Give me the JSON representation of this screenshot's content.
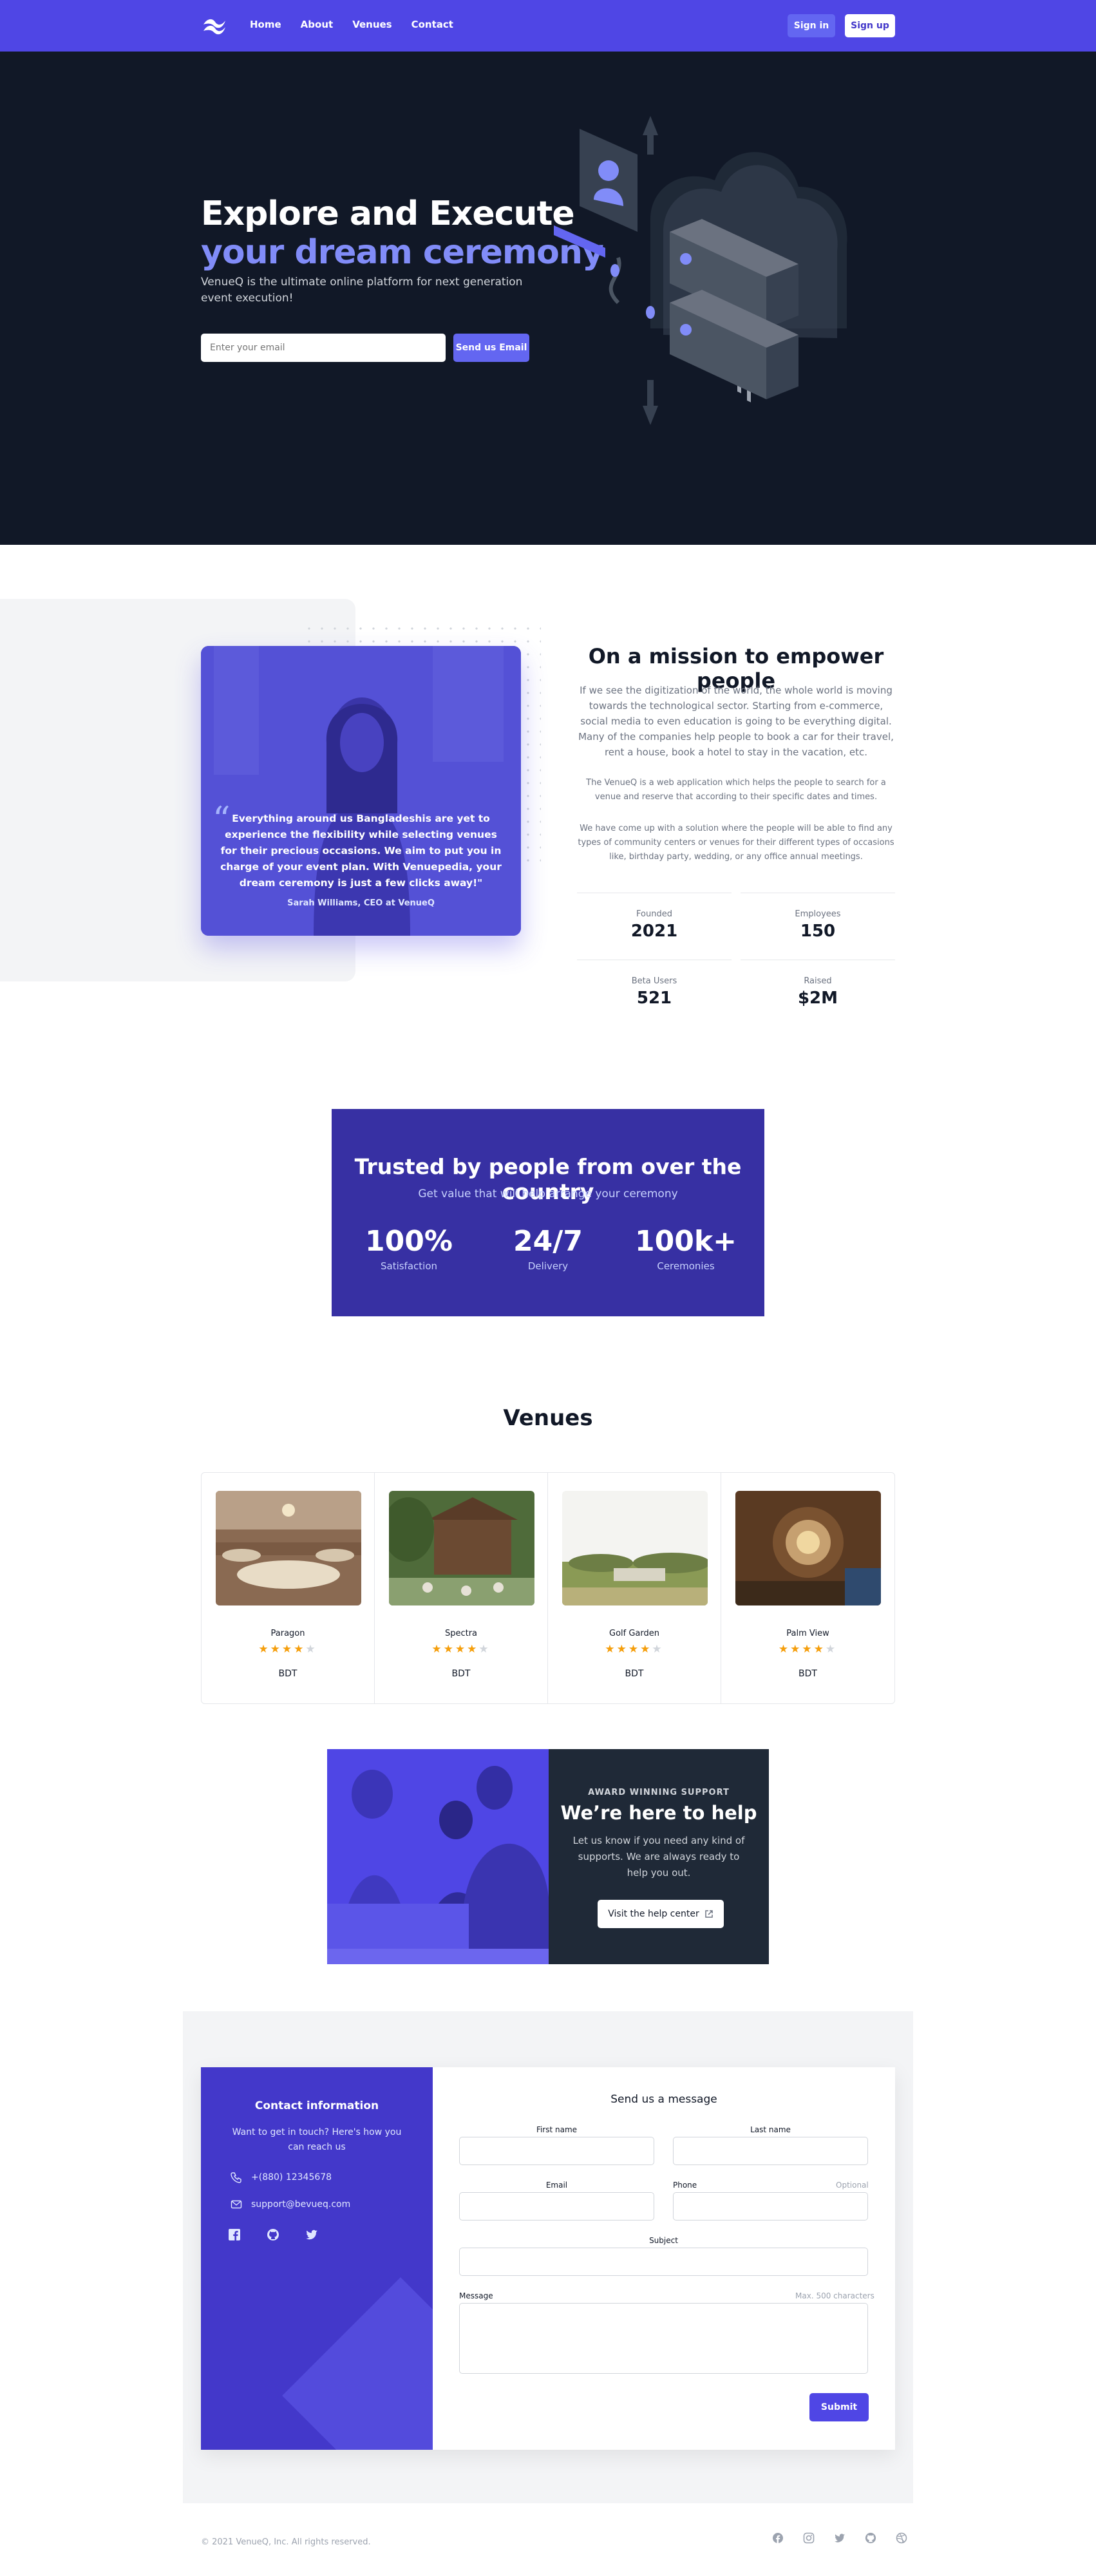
{
  "nav": {
    "links": [
      "Home",
      "About",
      "Venues",
      "Contact"
    ],
    "signin": "Sign in",
    "signup": "Sign up"
  },
  "hero": {
    "title_line1": "Explore and Execute",
    "title_line2": "your dream ceremony",
    "subtitle": "VenueQ is the ultimate online platform for next generation event execution!",
    "email_placeholder": "Enter your email",
    "send_button": "Send us Email"
  },
  "mission": {
    "quote": "Everything around us Bangladeshis are yet to experience the flexibility while selecting venues for their precious occasions. We aim to put you in charge of your event plan. With Venuepedia, your dream ceremony is just a few clicks away!\"",
    "quote_author": "Sarah Williams, CEO at VenueQ",
    "title": "On a mission to empower people",
    "paragraph1": "If we see the digitization of the world, the whole world is moving towards the technological sector. Starting from e-commerce, social media to even education is going to be everything digital. Many of the companies help people to book a car for their travel, rent a house, book a hotel to stay in the vacation, etc.",
    "paragraph2": "The VenueQ is a web application which helps the people to search for a venue and reserve that according to their specific dates and times.",
    "paragraph3": "We have come up with a solution where the people will be able to find any types of community centers or venues for their different types of occasions like, birthday party, wedding, or any office annual meetings.",
    "stats": [
      {
        "label": "Founded",
        "value": "2021"
      },
      {
        "label": "Employees",
        "value": "150"
      },
      {
        "label": "Beta Users",
        "value": "521"
      },
      {
        "label": "Raised",
        "value": "$2M"
      }
    ]
  },
  "trusted": {
    "title": "Trusted by people from over the country",
    "subtitle": "Get value that will help arrange your ceremony",
    "stats": [
      {
        "value": "100%",
        "label": "Satisfaction"
      },
      {
        "value": "24/7",
        "label": "Delivery"
      },
      {
        "value": "100k+",
        "label": "Ceremonies"
      }
    ]
  },
  "venues": {
    "title": "Venues",
    "items": [
      {
        "name": "Paragon",
        "rating": 4,
        "currency": "BDT"
      },
      {
        "name": "Spectra",
        "rating": 4,
        "currency": "BDT"
      },
      {
        "name": "Golf Garden",
        "rating": 4,
        "currency": "BDT"
      },
      {
        "name": "Palm View",
        "rating": 4,
        "currency": "BDT"
      }
    ]
  },
  "help": {
    "kicker": "AWARD WINNING SUPPORT",
    "title": "We’re here to help",
    "text": "Let us know if you need any kind of supports. We are always ready to help you out.",
    "button": "Visit the help center"
  },
  "contact": {
    "info_title": "Contact information",
    "info_text": "Want to get in touch? Here's how you can reach us",
    "phone": "+(880) 12345678",
    "email": "support@bevueq.com",
    "form_title": "Send us a message",
    "first_name": "First name",
    "last_name": "Last name",
    "email_label": "Email",
    "phone_label": "Phone",
    "phone_hint": "Optional",
    "subject": "Subject",
    "message": "Message",
    "message_hint": "Max. 500 characters",
    "submit": "Submit"
  },
  "footer": {
    "copyright": "© 2021 VenueQ, Inc. All rights reserved."
  },
  "colors": {
    "primary": "#4f46e5",
    "dark": "#111827",
    "accent": "#818cf8",
    "indigo_dark": "#3730a3",
    "star": "#f59e0b"
  }
}
